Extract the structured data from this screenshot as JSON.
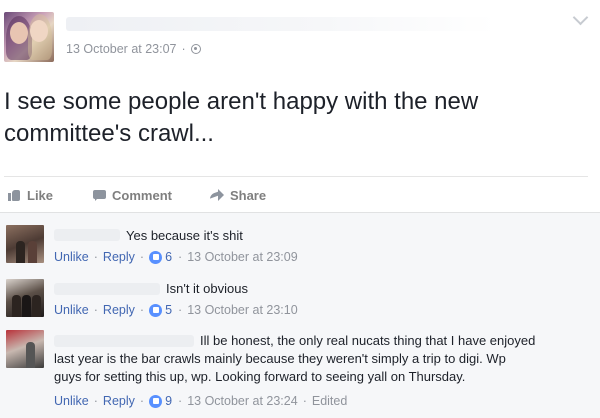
{
  "post": {
    "timestamp": "13 October at 23:07",
    "privacy_icon": "globe-icon",
    "text": "I see some people aren't happy with the new committee's crawl..."
  },
  "actions": {
    "like_label": "Like",
    "comment_label": "Comment",
    "share_label": "Share"
  },
  "comments": [
    {
      "text": "Yes because it's shit",
      "unlike_label": "Unlike",
      "reply_label": "Reply",
      "reactions": "6",
      "time": "13 October at 23:09",
      "edited": ""
    },
    {
      "text": "Isn't it obvious",
      "unlike_label": "Unlike",
      "reply_label": "Reply",
      "reactions": "5",
      "time": "13 October at 23:10",
      "edited": ""
    },
    {
      "text_line1": "Ill be honest, the only real nucats thing that I have enjoyed",
      "text_line2": "last year is the bar crawls mainly because they weren't simply a trip to digi. Wp",
      "text_line3": "guys for setting this up, wp. Looking forward to seeing yall on Thursday.",
      "unlike_label": "Unlike",
      "reply_label": "Reply",
      "reactions": "9",
      "time": "13 October at 23:24",
      "edited": "Edited"
    }
  ],
  "colors": {
    "link": "#4267b2",
    "meta": "#90949c",
    "reaction": "#5890ff",
    "comments_bg": "#f6f7f9"
  }
}
